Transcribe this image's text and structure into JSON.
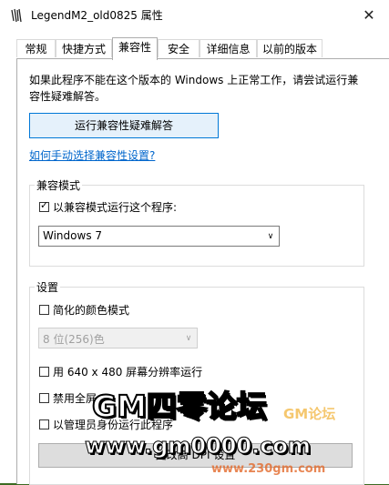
{
  "window": {
    "title": "LegendM2_old0825 属性",
    "close_glyph": "✕"
  },
  "tabs": [
    {
      "label": "常规",
      "active": false
    },
    {
      "label": "快捷方式",
      "active": false
    },
    {
      "label": "兼容性",
      "active": true
    },
    {
      "label": "安全",
      "active": false
    },
    {
      "label": "详细信息",
      "active": false
    },
    {
      "label": "以前的版本",
      "active": false
    }
  ],
  "compat": {
    "intro": "如果此程序不能在这个版本的 Windows 上正常工作，请尝试运行兼容性疑难解答。",
    "troubleshoot_button": "运行兼容性疑难解答",
    "manual_link": "如何手动选择兼容性设置?",
    "mode_group": {
      "label": "兼容模式",
      "checkbox_label": "以兼容模式运行这个程序:",
      "checked": true,
      "selected_os": "Windows 7"
    },
    "settings_group": {
      "label": "设置",
      "reduced_color": {
        "label": "简化的颜色模式",
        "checked": false
      },
      "color_select": "8 位(256)色",
      "resolution": {
        "label": "用 640 x 480 屏幕分辨率运行",
        "checked": false
      },
      "disable_fullscreen": {
        "label": "禁用全屏",
        "checked": false
      },
      "run_as_admin": {
        "label": "以管理员身份运行此程序",
        "checked": false
      },
      "dpi_button": "更改高 DPI 设置"
    }
  },
  "watermark": {
    "main": "GM四零论坛",
    "url": "www.gm0000.com",
    "red": "GM论坛",
    "small_url": "www.230gm.com"
  }
}
